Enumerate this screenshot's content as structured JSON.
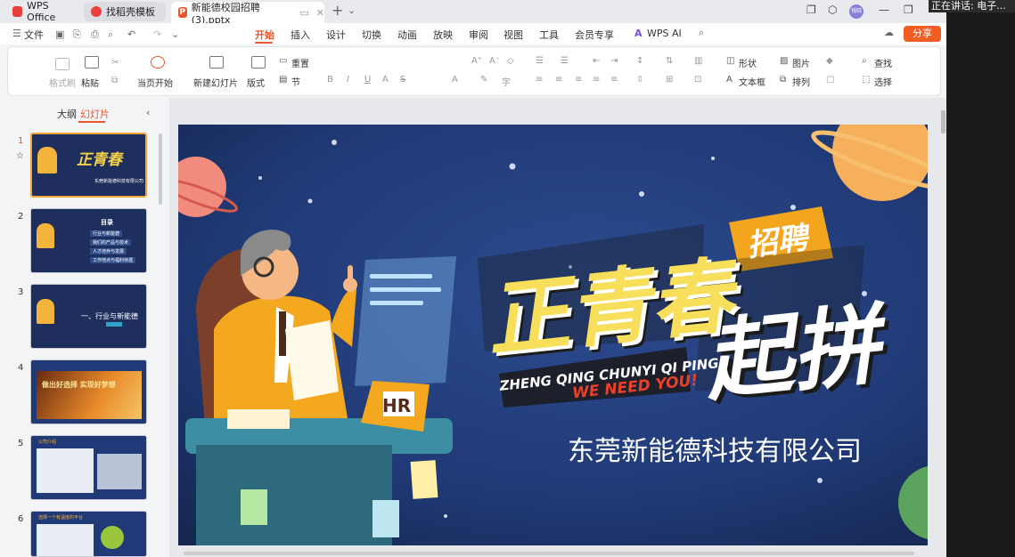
{
  "tabs": {
    "wps_label": "WPS Office",
    "template_label": "找稻壳模板",
    "file_label": "新能德校园招聘(3).pptx"
  },
  "overlay": {
    "speaking": "正在讲话: 电子..."
  },
  "user": {
    "avatar_text": "钱晓"
  },
  "menu": {
    "file": "文件",
    "items": [
      "开始",
      "插入",
      "设计",
      "切换",
      "动画",
      "放映",
      "审阅",
      "视图",
      "工具",
      "会员专享"
    ],
    "active": "开始",
    "wps_ai": "WPS AI",
    "share": "分享"
  },
  "ribbon": {
    "format_painter": "格式刷",
    "paste": "粘贴",
    "from_current": "当页开始",
    "new_slide": "新建幻灯片",
    "layout": "版式",
    "section": "节",
    "reset": "重置",
    "shape": "形状",
    "picture": "图片",
    "textbox": "文本框",
    "arrange": "排列",
    "find": "查找",
    "select": "选择"
  },
  "panel": {
    "outline": "大纲",
    "slides": "幻灯片",
    "slide_numbers": [
      "1",
      "2",
      "3",
      "4",
      "5",
      "6"
    ],
    "thumb2_title": "目录",
    "thumb2_items": [
      "行业与新能德",
      "我们的产品与技术",
      "人才培养与发展",
      "工作地点与福利待遇"
    ],
    "thumb3_title": "一、行业与新能德",
    "thumb4_title": "做出好选择 实现好梦想",
    "thumb5_title": "公司介绍",
    "thumb6_title": "选择一个有温度的平台"
  },
  "slide": {
    "recruit_badge": "招聘",
    "headline_1": "正青春",
    "headline_2": "起拼",
    "pinyin": "ZHENG QING CHUNYI QI PING",
    "we_need_you": "WE NEED YOU!",
    "company": "东莞新能德科技有限公司",
    "hr_sign": "HR"
  }
}
